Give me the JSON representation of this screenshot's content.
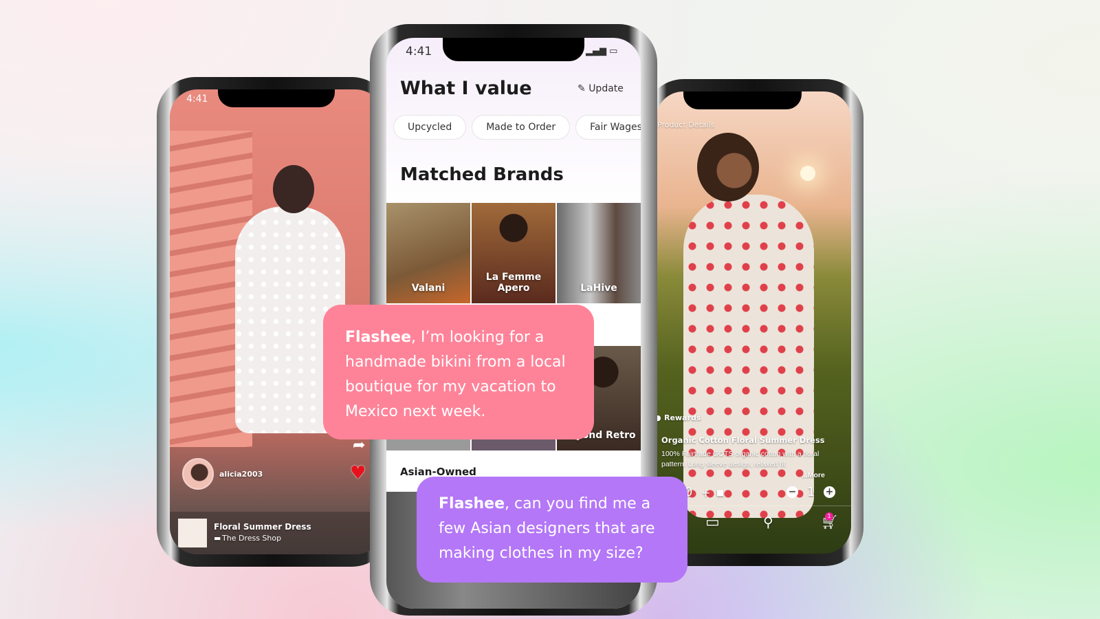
{
  "left_phone": {
    "time": "4:41",
    "username": "alicia2003",
    "product_title": "Floral Summer Dress",
    "shop_name": "The Dress Shop",
    "icons": [
      "share-icon",
      "heart-icon",
      "shop-icon"
    ]
  },
  "middle_phone": {
    "time": "4:41",
    "values_title": "What I value",
    "update_label": "Update",
    "value_chips": [
      "Upcycled",
      "Made to Order",
      "Fair Wages"
    ],
    "matched_title": "Matched Brands",
    "brands": [
      "Valani",
      "La Femme Apero",
      "LaHive",
      "Beyond Retro"
    ],
    "section_title": "Asian-Owned"
  },
  "right_phone": {
    "header": "Product Details",
    "rewards_label": "Rewards",
    "product_title": "Organic Cotton Floral Summer Dress",
    "description": "100% Fairtrade GOTS organic cotton with a floral pattern. Long sleeve design, relaxed fit",
    "more_label": "...More",
    "price_fragment": "0",
    "quantity": "1",
    "cart_badge": "1"
  },
  "bubbles": {
    "pink": {
      "bold": "Flashee",
      "text": ", I’m looking for a handmade bikini from a local boutique for my vacation to Mexico next week.",
      "color": "#fe8399"
    },
    "purple": {
      "bold": "Flashee",
      "text": ", can you find me a few Asian designers that are making clothes in my size?",
      "color": "#b477f7"
    }
  }
}
